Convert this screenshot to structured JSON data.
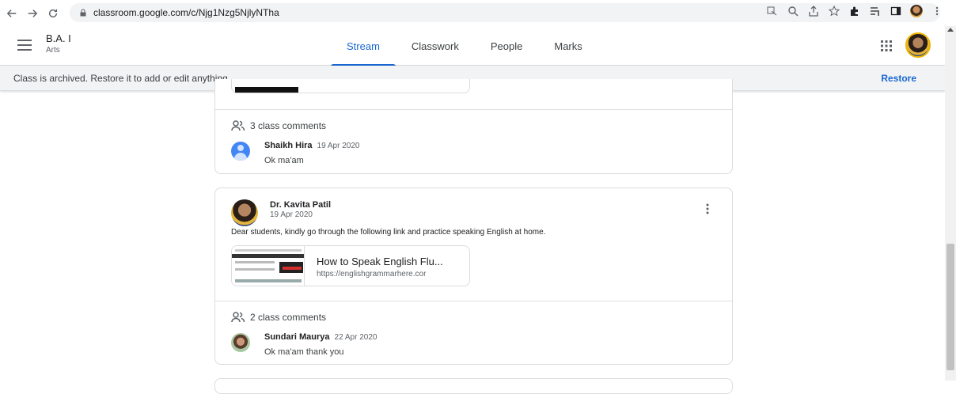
{
  "browser": {
    "url": "classroom.google.com/c/Njg1Nzg5NjlyNTha"
  },
  "header": {
    "class_title": "B.A. I",
    "class_section": "Arts",
    "tabs": [
      {
        "label": "Stream",
        "active": true
      },
      {
        "label": "Classwork",
        "active": false
      },
      {
        "label": "People",
        "active": false
      },
      {
        "label": "Marks",
        "active": false
      }
    ]
  },
  "banner": {
    "message": "Class is archived. Restore it to add or edit anything.",
    "restore_label": "Restore"
  },
  "posts": [
    {
      "comments_count_label": "3 class comments",
      "comments": [
        {
          "author": "Shaikh Hira",
          "date": "19 Apr 2020",
          "text": "Ok ma'am"
        }
      ]
    },
    {
      "author": "Dr. Kavita Patil",
      "date": "19 Apr 2020",
      "text": "Dear students, kindly go through the following link and practice speaking English at home.",
      "attachment": {
        "title": "How to Speak English Flu...",
        "url": "https://englishgrammarhere.cor"
      },
      "comments_count_label": "2 class comments",
      "comments": [
        {
          "author": "Sundari Maurya",
          "date": "22 Apr 2020",
          "text": "Ok ma'am thank you"
        }
      ]
    }
  ],
  "colors": {
    "accent": "#1967d2",
    "banner_bg": "#f1f3f4",
    "border": "#dadce0"
  }
}
